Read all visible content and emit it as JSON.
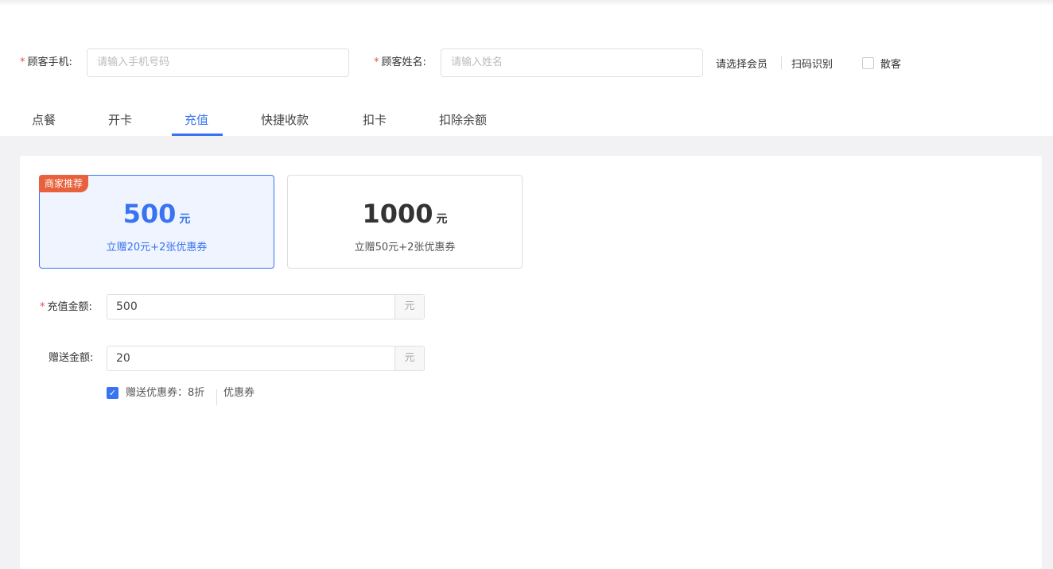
{
  "customer": {
    "phone_label": "顾客手机:",
    "phone_placeholder": "请输入手机号码",
    "name_label": "顾客姓名:",
    "name_placeholder": "请输入姓名",
    "required_mark": "*",
    "select_member": "请选择会员",
    "scan": "扫码识别",
    "walk_in": "散客"
  },
  "tabs": [
    {
      "label": "点餐"
    },
    {
      "label": "开卡"
    },
    {
      "label": "充值"
    },
    {
      "label": "快捷收款"
    },
    {
      "label": "扣卡"
    },
    {
      "label": "扣除余额"
    }
  ],
  "packages": [
    {
      "badge": "商家推荐",
      "amount": "500",
      "unit": "元",
      "desc": "立赠20元+2张优惠券"
    },
    {
      "amount": "1000",
      "unit": "元",
      "desc": "立赠50元+2张优惠券"
    }
  ],
  "form": {
    "recharge_label": "充值金额:",
    "recharge_value": "500",
    "gift_label": "赠送金额:",
    "gift_value": "20",
    "unit": "元",
    "coupon_label": "赠送优惠券：8折",
    "coupon_link": "优惠券"
  },
  "colors": {
    "accent": "#3874f2",
    "badge": "#e8603c"
  }
}
